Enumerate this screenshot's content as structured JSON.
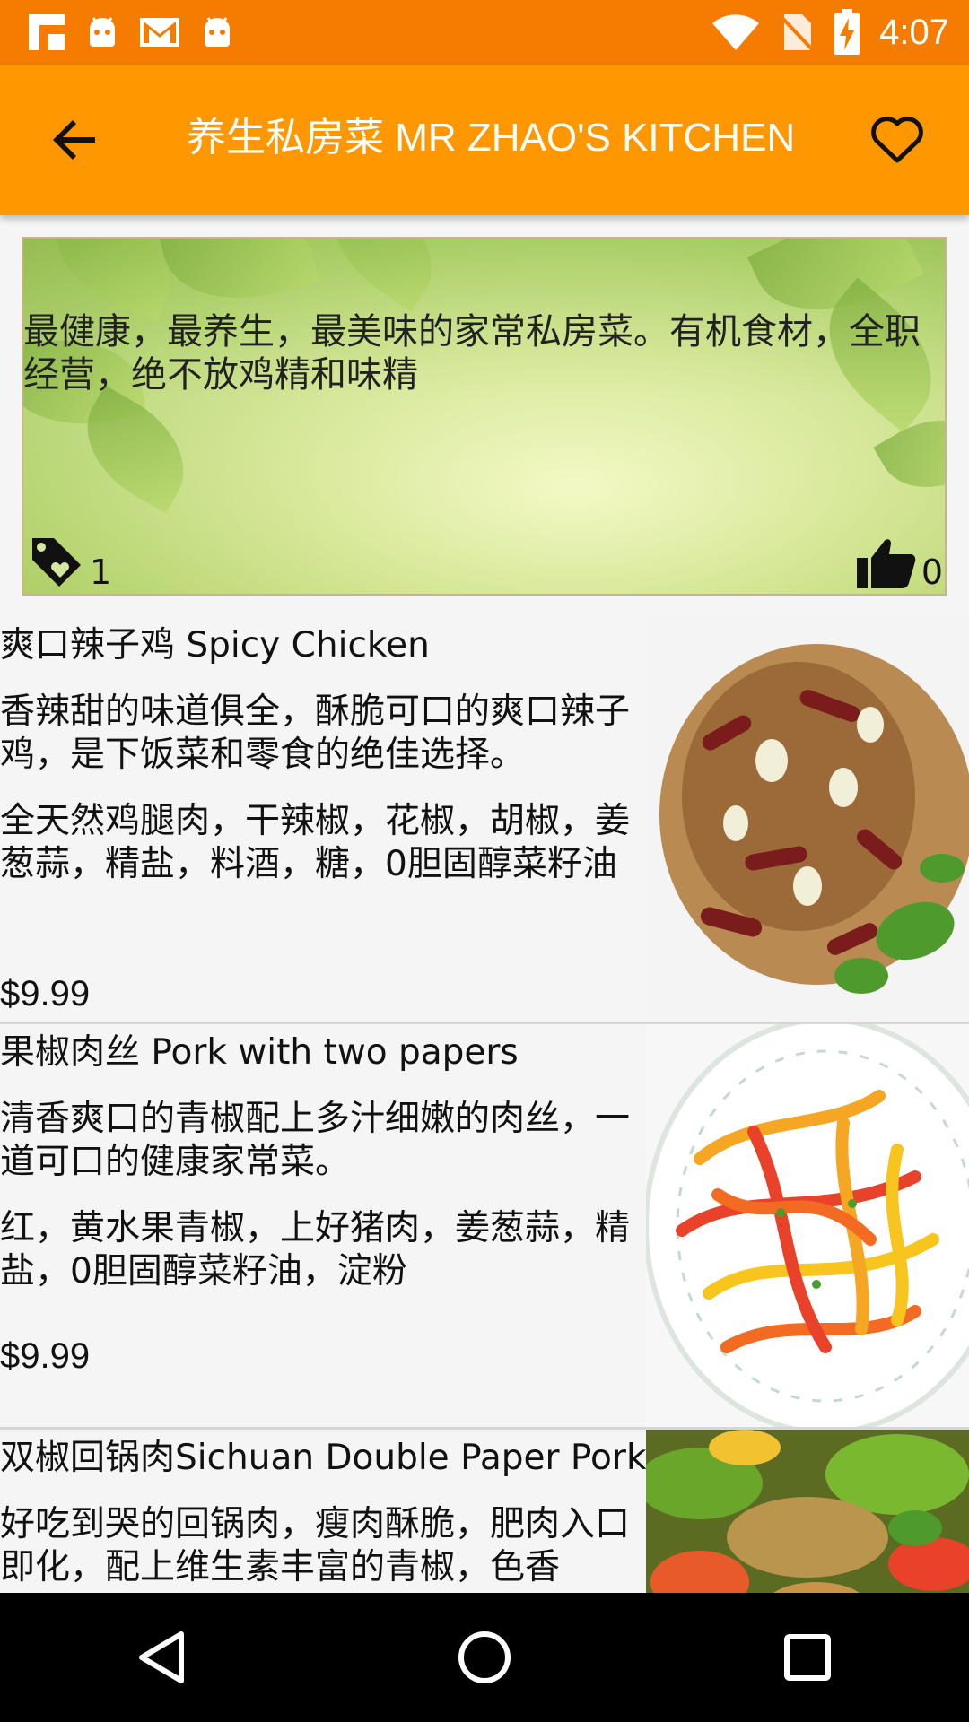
{
  "status_bar": {
    "time": "4:07",
    "left_icons": [
      "flipboard-icon",
      "android-icon",
      "gmail-icon",
      "android-icon"
    ],
    "right_icons": [
      "wifi-icon",
      "no-sim-icon",
      "battery-charging-icon"
    ]
  },
  "app_bar": {
    "title": "养生私房菜 MR ZHAO'S KITCHEN",
    "back_icon": "arrow-back-icon",
    "favorite_icon": "heart-outline-icon",
    "color": "#FF9800",
    "status_color": "#F57C00"
  },
  "banner": {
    "description": "最健康，最养生，最美味的家常私房菜。有机食材，全职经营，绝不放鸡精和味精",
    "tag_count": "1",
    "like_count": "0"
  },
  "dishes": [
    {
      "name": "爽口辣子鸡 Spicy Chicken",
      "description": "香辣甜的味道俱全，酥脆可口的爽口辣子鸡，是下饭菜和零食的绝佳选择。",
      "ingredients": "全天然鸡腿肉，干辣椒，花椒，胡椒，姜葱蒜，精盐，料酒，糖，0胆固醇菜籽油",
      "price": "$9.99"
    },
    {
      "name": "果椒肉丝 Pork with two papers",
      "description": "清香爽口的青椒配上多汁细嫩的肉丝，一道可口的健康家常菜。",
      "ingredients": "红，黄水果青椒，上好猪肉，姜葱蒜，精盐，0胆固醇菜籽油，淀粉",
      "price": "$9.99"
    },
    {
      "name": "双椒回锅肉Sichuan Double Paper Pork",
      "description": "好吃到哭的回锅肉，瘦肉酥脆，肥肉入口即化，配上维生素丰富的青椒，色香",
      "ingredients": "",
      "price": ""
    }
  ],
  "nav_bar": {
    "back_icon": "nav-back-triangle-icon",
    "home_icon": "nav-home-circle-icon",
    "recents_icon": "nav-recents-square-icon"
  }
}
